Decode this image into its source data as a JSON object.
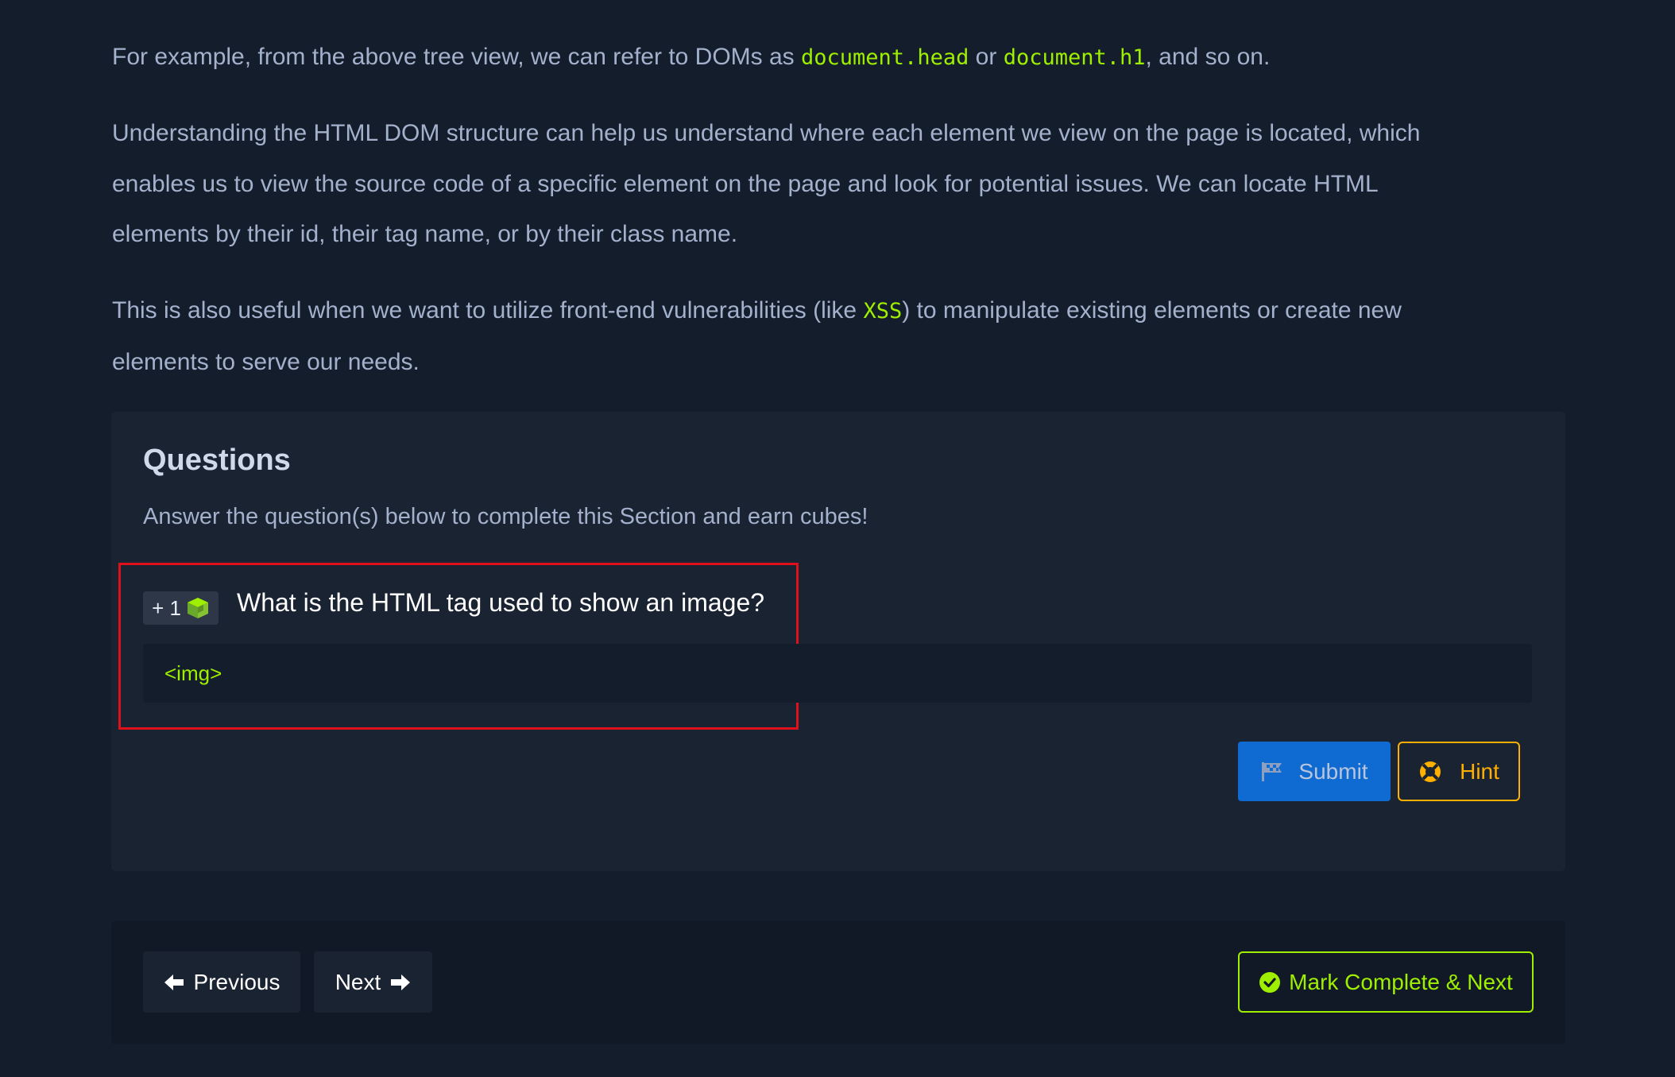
{
  "paragraphs": {
    "p1": {
      "t1": "For example, from the above tree view, we can refer to DOMs as ",
      "c1": "document.head",
      "t2": " or ",
      "c2": "document.h1",
      "t3": ", and so on."
    },
    "p2": {
      "line1": "Understanding the HTML DOM structure can help us understand where each element we view on the page is located, which",
      "line2": "enables us to view the source code of a specific element on the page and look for potential issues. We can locate HTML",
      "line3": "elements by their id, their tag name, or by their class name."
    },
    "p3": {
      "t1": "This is also useful when we want to utilize front-end vulnerabilities (like ",
      "c1": "XSS",
      "t2": ") to manipulate existing elements or create new",
      "line2": "elements to serve our needs."
    }
  },
  "questions": {
    "title": "Questions",
    "subtitle": "Answer the question(s) below to complete this Section and earn cubes!",
    "badge": "+ 1",
    "badge_icon": "cube-icon",
    "question_text": "What is the HTML tag used to show an image?",
    "answer_value": "<img>",
    "submit_label": "Submit",
    "submit_icon": "flag-icon",
    "hint_label": "Hint",
    "hint_icon": "lifebuoy-icon"
  },
  "navigation": {
    "previous_label": "Previous",
    "next_label": "Next",
    "mark_complete_label": "Mark Complete & Next"
  },
  "colors": {
    "background": "#141d2b",
    "card": "#1a2332",
    "accent_green": "#9fef00",
    "submit_blue": "#0f6bd1",
    "hint_orange": "#ffaf00",
    "highlight_red": "#e0101a"
  }
}
